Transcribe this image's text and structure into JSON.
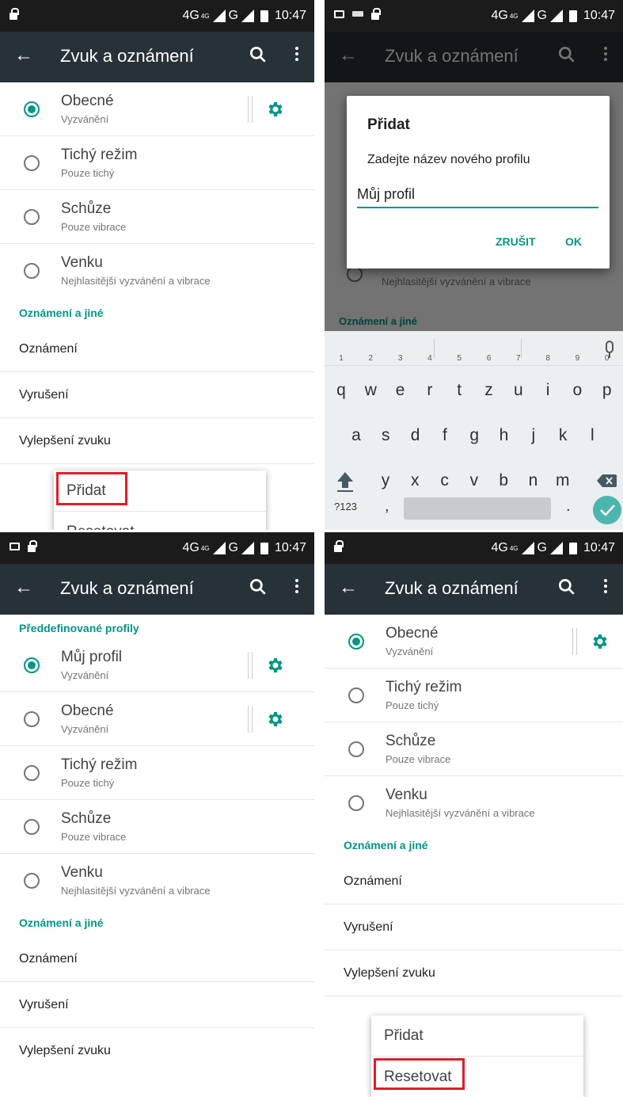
{
  "status": {
    "network": "4G",
    "network_sup": "4G",
    "signal2": "G",
    "time": "10:47"
  },
  "toolbar": {
    "title": "Zvuk a oznámení"
  },
  "profiles": {
    "obecne": {
      "name": "Obecné",
      "sub": "Vyzvánění"
    },
    "tichy": {
      "name": "Tichý režim",
      "sub": "Pouze tichý"
    },
    "schuze": {
      "name": "Schůze",
      "sub": "Pouze vibrace"
    },
    "venku": {
      "name": "Venku",
      "sub": "Nejhlasitější vyzvánění a vibrace"
    },
    "muj": {
      "name": "Můj profil",
      "sub": "Vyzvánění"
    }
  },
  "sections": {
    "oznameni": "Oznámení a jiné",
    "preddefinovane": "Předdefinované profily"
  },
  "items": {
    "oznameni": "Oznámení",
    "vyruseni": "Vyrušení",
    "vylepseni": "Vylepšení zvuku"
  },
  "menu": {
    "pridat": "Přidat",
    "resetovat": "Resetovat"
  },
  "dialog": {
    "title": "Přidat",
    "message": "Zadejte název nového profilu",
    "value": "Můj profil",
    "cancel": "ZRUŠIT",
    "ok": "OK"
  },
  "keyboard": {
    "row1": [
      "q",
      "w",
      "e",
      "r",
      "t",
      "z",
      "u",
      "i",
      "o",
      "p"
    ],
    "row1_hints": [
      "1",
      "2",
      "3",
      "4",
      "5",
      "6",
      "7",
      "8",
      "9",
      "0"
    ],
    "row2": [
      "a",
      "s",
      "d",
      "f",
      "g",
      "h",
      "j",
      "k",
      "l"
    ],
    "row3": [
      "y",
      "x",
      "c",
      "v",
      "b",
      "n",
      "m"
    ],
    "symbols": "?123",
    "comma": ",",
    "dot": "."
  },
  "highlight": {
    "color": "#e21c2b"
  },
  "colors": {
    "accent": "#009688",
    "toolbar": "#263238",
    "statusbar": "#1b1b1b"
  }
}
